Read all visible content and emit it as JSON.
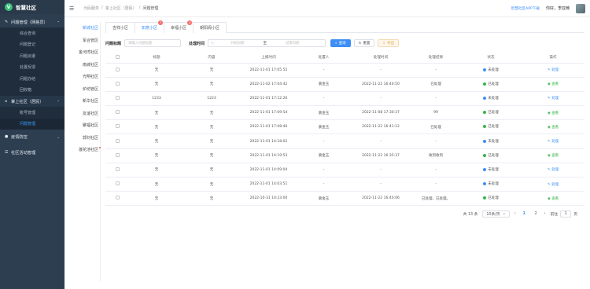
{
  "brand": {
    "logo_letter": "V",
    "name": "智慧社区"
  },
  "sidebar": {
    "groups": [
      {
        "label": "问题管理（网格员）",
        "icon": "edit-icon",
        "items": [
          "综合查询",
          "问题登记",
          "问题派遣",
          "处置反馈",
          "问题办结",
          "回收箱"
        ]
      },
      {
        "label": "掌上社区（居民）",
        "icon": "home-icon",
        "items": [
          "账号管理",
          "问题管理"
        ]
      },
      {
        "label": "疫情防控",
        "icon": "user-icon"
      },
      {
        "label": "社区活动管理",
        "icon": "list-icon"
      }
    ]
  },
  "topbar": {
    "breadcrumb": [
      "为民服务",
      "掌上社区（居民）",
      "问题管理"
    ],
    "app_link": "智慧社区APP下载",
    "greeting": "你好，李亚楠"
  },
  "communities": [
    "新城社区",
    "军合管区",
    "金河湾社区",
    "南城社区",
    "光明社区",
    "炉坊管区",
    "新华社区",
    "友谊社区",
    "聚福社区",
    "郭刘社区",
    "莲花池社区"
  ],
  "tabs": [
    {
      "label": "吉祥小区",
      "badge": ""
    },
    {
      "label": "如意小区",
      "badge": "7"
    },
    {
      "label": "幸福小区",
      "badge": "2"
    },
    {
      "label": "朝阳阁小区",
      "badge": ""
    }
  ],
  "filters": {
    "title_label": "问题标题",
    "title_placeholder": "请输入问题标题",
    "time_label": "处理时间",
    "start_placeholder": "开始日期",
    "range_sep": "至",
    "end_placeholder": "结束日期",
    "search_btn": "查询",
    "reset_btn": "重置",
    "export_btn": "导出"
  },
  "table": {
    "headers": [
      "标题",
      "内容",
      "上报时间",
      "处置人",
      "处理时间",
      "处理结果",
      "状态",
      "操作"
    ],
    "rows": [
      {
        "title": "无",
        "content": "无",
        "report_time": "2022-11-01 17:05:55",
        "handler": "-",
        "handle_time": "-",
        "result": "-",
        "status": "未处理",
        "action": "处理"
      },
      {
        "title": "无",
        "content": "无",
        "report_time": "2022-11-02 17:04:42",
        "handler": "裴金玉",
        "handle_time": "2022-11-22 16:40:50",
        "result": "已处理",
        "status": "已处理",
        "action": "查看"
      },
      {
        "title": "1233",
        "content": "1223",
        "report_time": "2022-11-01 17:12:26",
        "handler": "-",
        "handle_time": "-",
        "result": "-",
        "status": "未处理",
        "action": "处理"
      },
      {
        "title": "无",
        "content": "无",
        "report_time": "2022-11-01 17:09:54",
        "handler": "裴金玉",
        "handle_time": "2022-11-08 17:30:37",
        "result": "99",
        "status": "已处理",
        "action": "查看"
      },
      {
        "title": "无",
        "content": "无",
        "report_time": "2022-11-01 17:08:46",
        "handler": "裴金玉",
        "handle_time": "2022-11-22 16:41:12",
        "result": "已处理",
        "status": "已处理",
        "action": "查看"
      },
      {
        "title": "无",
        "content": "无",
        "report_time": "2022-11-01 14:18:02",
        "handler": "-",
        "handle_time": "-",
        "result": "-",
        "status": "未处理",
        "action": "处理"
      },
      {
        "title": "无",
        "content": "无",
        "report_time": "2022-11-01 14:19:53",
        "handler": "裴金玉",
        "handle_time": "2022-11-22 16:35:37",
        "result": "收到收到",
        "status": "已处理",
        "action": "查看"
      },
      {
        "title": "无",
        "content": "无",
        "report_time": "2022-11-01 14:09:04",
        "handler": "-",
        "handle_time": "-",
        "result": "-",
        "status": "未处理",
        "action": "处理"
      },
      {
        "title": "无",
        "content": "无",
        "report_time": "2022-11-01 14:03:51",
        "handler": "-",
        "handle_time": "-",
        "result": "-",
        "status": "未处理",
        "action": "处理"
      },
      {
        "title": "无",
        "content": "无",
        "report_time": "2022-10-31 10:23:00",
        "handler": "裴金玉",
        "handle_time": "2022-11-22 16:40:06",
        "result": "已处理，已处理。",
        "status": "已处理",
        "action": "查看"
      }
    ]
  },
  "pagination": {
    "total": "共 13 条",
    "page_size": "10条/页",
    "pages": [
      "1",
      "2"
    ],
    "goto_label": "前往",
    "goto_value": "1",
    "goto_suffix": "页"
  },
  "colors": {
    "pending": "#3e8ef7",
    "done": "#39b54a",
    "accent": "#3e8ef7"
  }
}
